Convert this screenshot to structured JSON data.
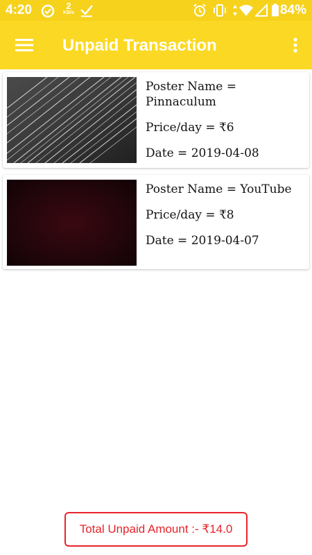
{
  "status_bar": {
    "time": "4:20",
    "network_speed_value": "2",
    "network_speed_unit": "KB/s",
    "battery_percent": "84%",
    "icons": [
      "sync-icon",
      "download-done-icon",
      "alarm-icon",
      "vibrate-icon",
      "data-arrows-icon",
      "wifi-icon",
      "signal-icon",
      "battery-icon"
    ]
  },
  "app_bar": {
    "title": "Unpaid Transaction",
    "menu_icon": "hamburger-menu-icon",
    "overflow_icon": "more-vert-icon",
    "background": "#fbd824"
  },
  "transactions": [
    {
      "poster_name": "Poster Name = Pinnaculum",
      "price_per_day": "Price/day = ₹6",
      "date": "Date = 2019-04-08",
      "thumbnail": "gray-diagonal-light-streaks"
    },
    {
      "poster_name": "Poster Name = YouTube",
      "price_per_day": "Price/day = ₹8",
      "date": "Date = 2019-04-07",
      "thumbnail": "dark-maroon-gradient"
    }
  ],
  "footer": {
    "total_label": "Total Unpaid Amount :- ₹14.0",
    "accent_color": "#e8232a"
  }
}
